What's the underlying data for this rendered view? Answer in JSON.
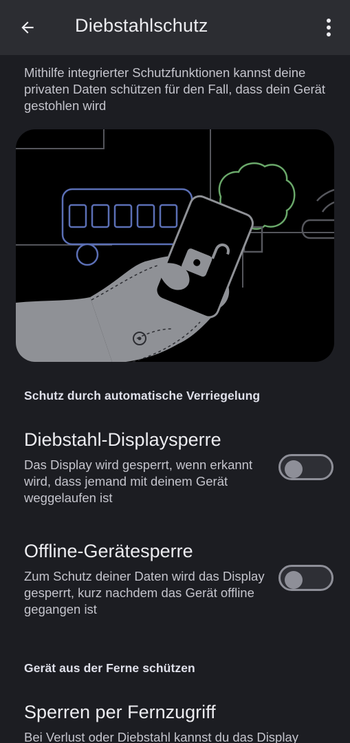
{
  "appbar": {
    "title": "Diebstahlschutz",
    "back_icon": "arrow-back-icon",
    "menu_icon": "more-vert-icon"
  },
  "intro_text": "Mithilfe integrierter Schutzfunktionen kannst deine privaten Daten schützen für den Fall, dass dein Gerät gestohlen wird",
  "sections": {
    "auto_lock": {
      "header": "Schutz durch automatische Verriegelung",
      "theft_lock": {
        "title": "Diebstahl-Displaysperre",
        "description": "Das Display wird gesperrt, wenn erkannt wird, dass jemand mit deinem Gerät weggelaufen ist",
        "enabled": false
      },
      "offline_lock": {
        "title": "Offline-Gerätesperre",
        "description": "Zum Schutz deiner Daten wird das Display gesperrt, kurz nachdem das Gerät offline gegangen ist",
        "enabled": false
      }
    },
    "remote": {
      "header": "Gerät aus der Ferne schützen",
      "remote_lock": {
        "title": "Sperren per Fernzugriff",
        "description": "Bei Verlust oder Diebstahl kannst du das Display"
      }
    }
  },
  "colors": {
    "background": "#1c1d22",
    "appbar": "#2c2d32",
    "bus_outline": "#5b6fb5",
    "tree_outline": "#6aa86a",
    "hand_fill": "#8f9196"
  }
}
